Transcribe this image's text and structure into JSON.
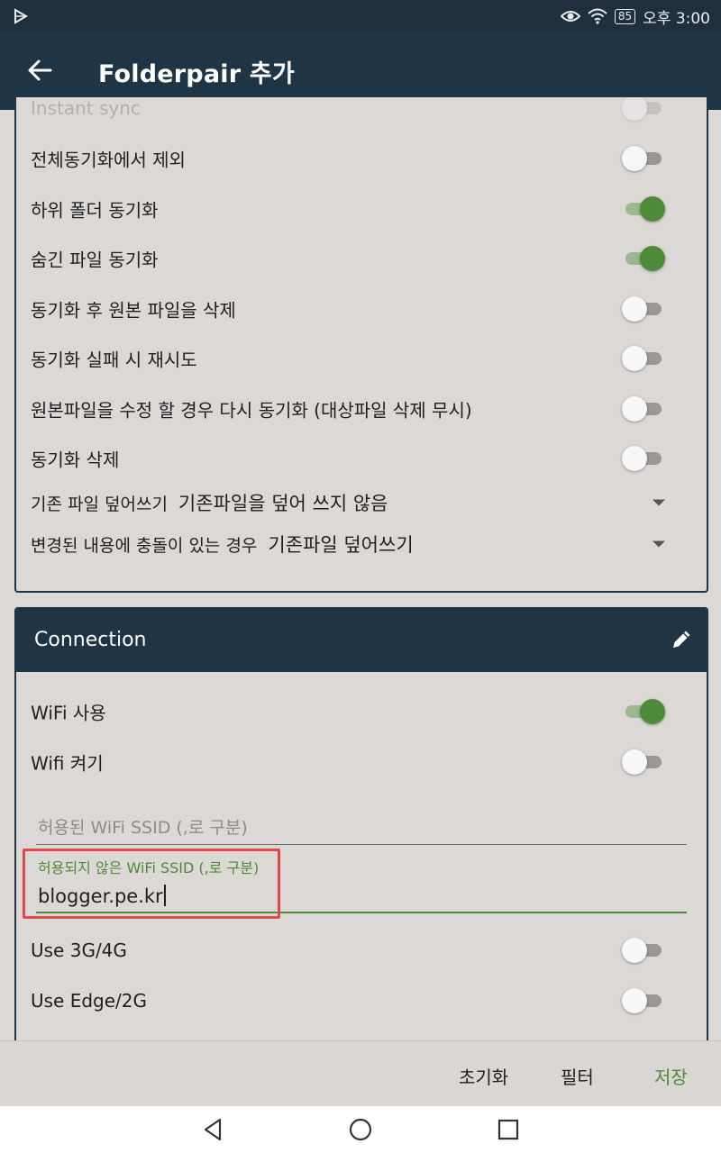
{
  "status_bar": {
    "battery": "85",
    "time": "오후 3:00"
  },
  "app_bar": {
    "title": "Folderpair 추가"
  },
  "sync_settings": {
    "rows": [
      {
        "label": "Instant sync",
        "on": false,
        "disabled": true
      },
      {
        "label": "전체동기화에서 제외",
        "on": false
      },
      {
        "label": "하위 폴더 동기화",
        "on": true
      },
      {
        "label": "숨긴 파일 동기화",
        "on": true
      },
      {
        "label": "동기화 후 원본 파일을 삭제",
        "on": false
      },
      {
        "label": "동기화 실패 시 재시도",
        "on": false
      },
      {
        "label": "원본파일을 수정 할 경우 다시 동기화 (대상파일 삭제 무시)",
        "on": false
      },
      {
        "label": "동기화 삭제",
        "on": false
      }
    ],
    "selects": [
      {
        "label": "기존 파일 덮어쓰기",
        "value": "기존파일을 덮어 쓰지 않음"
      },
      {
        "label": "변경된 내용에 충돌이 있는 경우",
        "value": "기존파일 덮어쓰기"
      }
    ]
  },
  "connection": {
    "title": "Connection",
    "rows": [
      {
        "label": "WiFi 사용",
        "on": true
      },
      {
        "label": "Wifi 켜기",
        "on": false
      }
    ],
    "allowed_ssid": {
      "placeholder": "허용된 WiFi SSID (,로 구분)"
    },
    "disallowed_ssid": {
      "label": "허용되지 않은 WiFi SSID (,로 구분)",
      "value": "blogger.pe.kr"
    },
    "rows_after": [
      {
        "label": "Use 3G/4G",
        "on": false
      },
      {
        "label": "Use Edge/2G",
        "on": false
      }
    ]
  },
  "actions": {
    "reset": "초기화",
    "filter": "필터",
    "save": "저장"
  },
  "colors": {
    "primary": "#1f3445",
    "accent": "#4f8a3a",
    "highlight": "#e24848"
  }
}
